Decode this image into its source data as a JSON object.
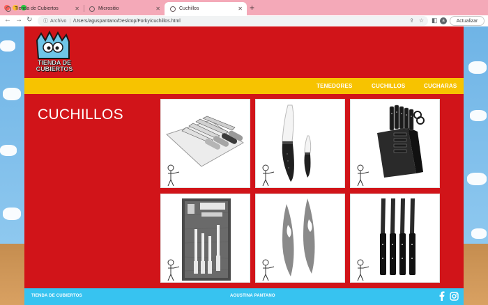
{
  "browser": {
    "tabs": [
      {
        "title": "Tienda de Cubiertos",
        "active": false
      },
      {
        "title": "Micrositio",
        "active": false
      },
      {
        "title": "Cuchillos",
        "active": true
      }
    ],
    "address": {
      "protocol_label": "Archivo",
      "path": "/Users/aguspantano/Desktop/Forky/cuchillos.html"
    },
    "profile_initial": "a",
    "update_button": "Actualizar"
  },
  "site": {
    "logo": {
      "line1": "TIENDA DE",
      "line2": "CUBIERTOS"
    },
    "nav": [
      "TENEDORES",
      "CUCHILLOS",
      "CUCHARAS"
    ],
    "page_title": "CUCHILLOS",
    "products": [
      {
        "name": "knife-set-with-cutting-board-icon"
      },
      {
        "name": "ceramic-knives-icon"
      },
      {
        "name": "knife-block-set-icon"
      },
      {
        "name": "boxed-knife-set-icon"
      },
      {
        "name": "knives-with-sheaths-icon"
      },
      {
        "name": "steak-knives-icon"
      }
    ],
    "footer": {
      "left": "TIENDA DE CUBIERTOS",
      "center": "AGUSTINA PANTANO"
    }
  },
  "colors": {
    "brand_red": "#d11419",
    "nav_yellow": "#f7c300",
    "footer_blue": "#37c3f0"
  }
}
